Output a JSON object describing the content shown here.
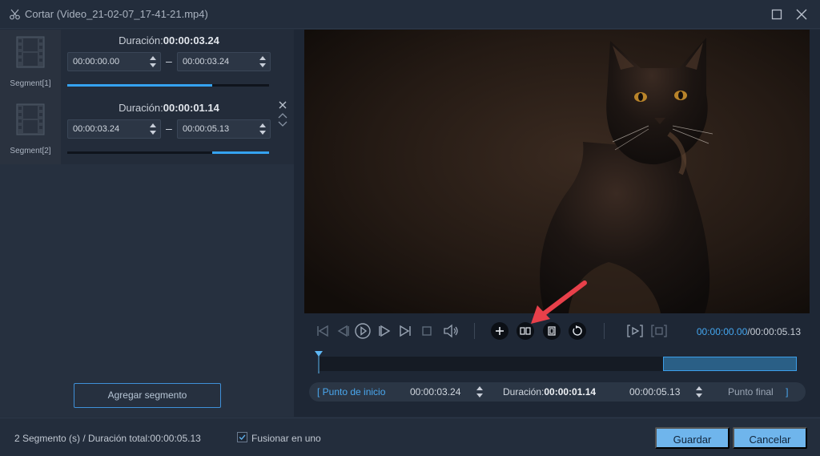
{
  "window": {
    "title": "Cortar (Video_21-02-07_17-41-21.mp4)",
    "app_icon": "scissors-icon",
    "maximize_icon": "maximize-icon",
    "close_icon": "close-icon"
  },
  "segments": [
    {
      "label": "Segment[1]",
      "duration_label": "Duración:",
      "duration_value": "00:00:03.24",
      "start": "00:00:00.00",
      "end": "00:00:03.24",
      "progress_start": 0.0,
      "progress_end": 0.72
    },
    {
      "label": "Segment[2]",
      "duration_label": "Duración:",
      "duration_value": "00:00:01.14",
      "start": "00:00:03.24",
      "end": "00:00:05.13",
      "progress_start": 0.72,
      "progress_end": 1.0
    }
  ],
  "add_segment_label": "Agregar segmento",
  "player": {
    "current_time": "00:00:00.00",
    "total_time": "/00:00:05.13",
    "selection_start": 0.72,
    "selection_end": 1.0
  },
  "range": {
    "start_label": "Punto de inicio",
    "start_value": "00:00:03.24",
    "duration_label": "Duración:",
    "duration_value": "00:00:01.14",
    "end_value": "00:00:05.13",
    "end_label": "Punto final"
  },
  "footer": {
    "summary": "2 Segmento (s) / Duración total:00:00:05.13",
    "merge_label": "Fusionar en uno",
    "merge_checked": true,
    "save_label": "Guardar",
    "cancel_label": "Cancelar"
  },
  "colors": {
    "accent": "#35a2f0",
    "button": "#6fb5ec",
    "arrow": "#e8404a"
  }
}
